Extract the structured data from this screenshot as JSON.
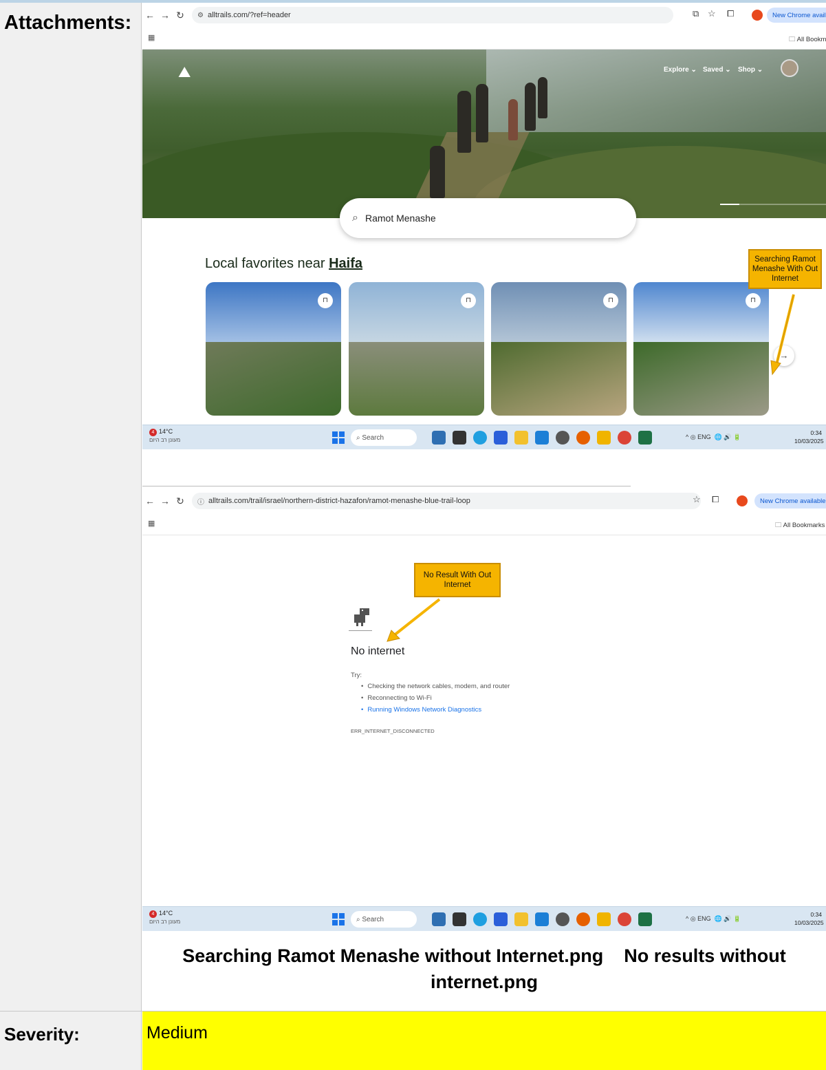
{
  "doc": {
    "attachments_label": "Attachments:",
    "severity_label": "Severity:",
    "severity_value": "Medium",
    "caption_part1": "Searching Ramot Menashe without Internet.png",
    "caption_part2": "No results without internet.png"
  },
  "shot1": {
    "url": "alltrails.com/?ref=header",
    "update_pill": "New Chrome available",
    "bookmarks": "All Bookmarks",
    "nav": {
      "explore": "Explore ⌄",
      "saved": "Saved ⌄",
      "shop": "Shop ⌄"
    },
    "search_value": "Ramot Menashe",
    "local_prefix": "Local favorites near",
    "local_city": "Haifa",
    "callout": "Searching Ramot Menashe With Out Internet"
  },
  "shot2": {
    "url": "alltrails.com/trail/israel/northern-district-hazafon/ramot-menashe-blue-trail-loop",
    "update_pill": "New Chrome available",
    "bookmarks": "All Bookmarks",
    "callout": "No Result With Out Internet",
    "title": "No internet",
    "try": "Try:",
    "tips": [
      "Checking the network cables, modem, and router",
      "Reconnecting to Wi-Fi",
      "Running Windows Network Diagnostics"
    ],
    "error_code": "ERR_INTERNET_DISCONNECTED"
  },
  "taskbar": {
    "temp": "14°C",
    "condition": "מעונן רב היום",
    "weather_badge": "4",
    "search": "Search",
    "tray": "^ ◎ ENG",
    "time": "0:34",
    "date": "10/03/2025"
  },
  "colors": {
    "severity_bg": "#ffff00",
    "callout_bg": "#f5b400",
    "link": "#1a73e8",
    "update_pill": "#d3e3fd"
  }
}
